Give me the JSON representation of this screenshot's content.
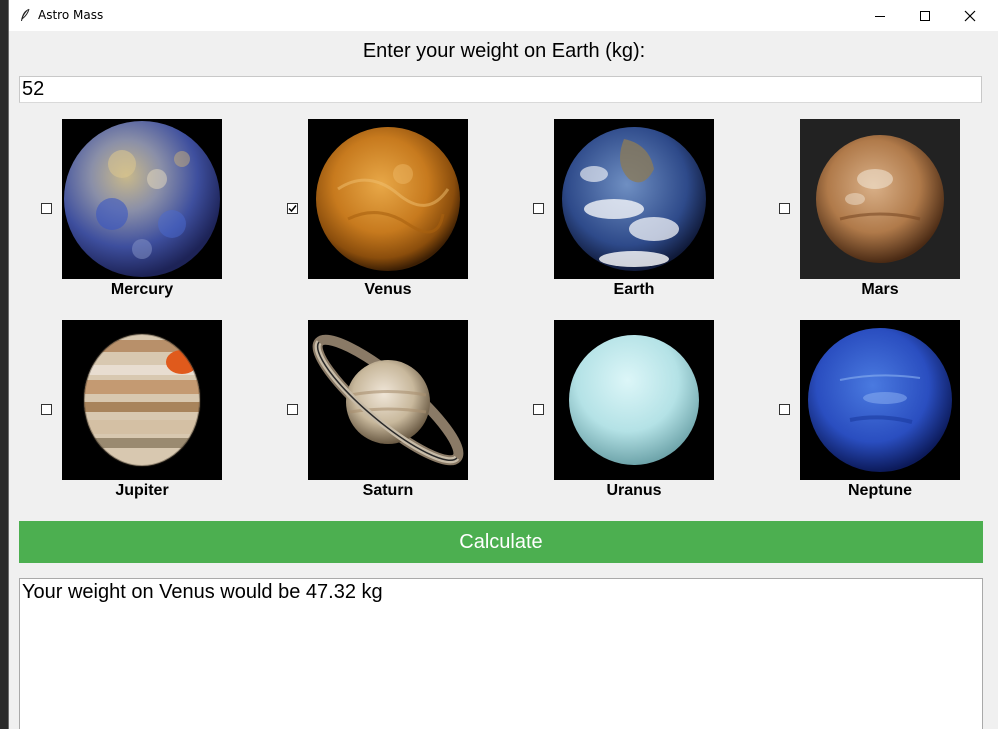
{
  "window": {
    "title": "Astro Mass",
    "icon": "feather-icon"
  },
  "prompt": "Enter your weight on Earth (kg):",
  "weight_input": {
    "value": "52"
  },
  "planets": [
    {
      "name": "Mercury",
      "checked": false
    },
    {
      "name": "Venus",
      "checked": true
    },
    {
      "name": "Earth",
      "checked": false
    },
    {
      "name": "Mars",
      "checked": false
    },
    {
      "name": "Jupiter",
      "checked": false
    },
    {
      "name": "Saturn",
      "checked": false
    },
    {
      "name": "Uranus",
      "checked": false
    },
    {
      "name": "Neptune",
      "checked": false
    }
  ],
  "calculate_label": "Calculate",
  "result_text": "Your weight on Venus would be 47.32 kg",
  "colors": {
    "calculate_bg": "#4caf50",
    "window_bg": "#f0f0f0"
  }
}
